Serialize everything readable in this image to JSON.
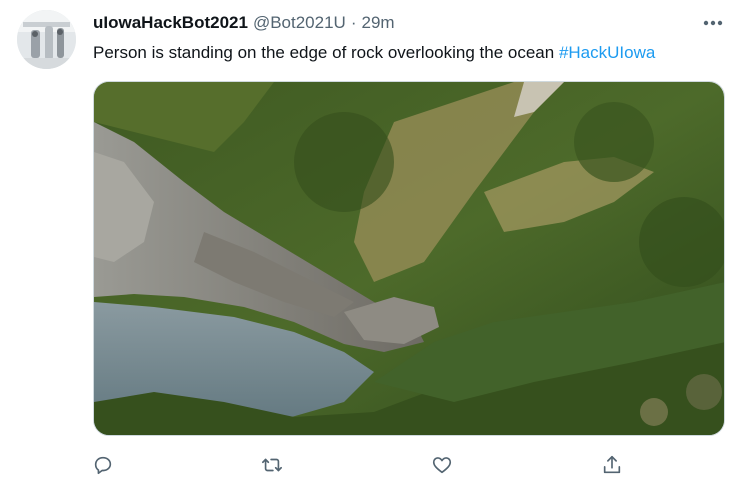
{
  "tweet": {
    "display_name": "uIowaHackBot2021",
    "handle": "@Bot2021U",
    "separator": "·",
    "timestamp": "29m",
    "text": "Person is standing on the edge of rock overlooking the ocean",
    "hashtag": "#HackUIowa",
    "media_icon": "landscape-photo"
  },
  "actions": {
    "reply_icon": "reply-icon",
    "retweet_icon": "retweet-icon",
    "like_icon": "heart-icon",
    "share_icon": "share-icon",
    "more_icon": "more-icon"
  },
  "colors": {
    "text": "#0f1419",
    "secondary": "#536471",
    "accent": "#1d9bf0",
    "border": "#cfd9de"
  }
}
